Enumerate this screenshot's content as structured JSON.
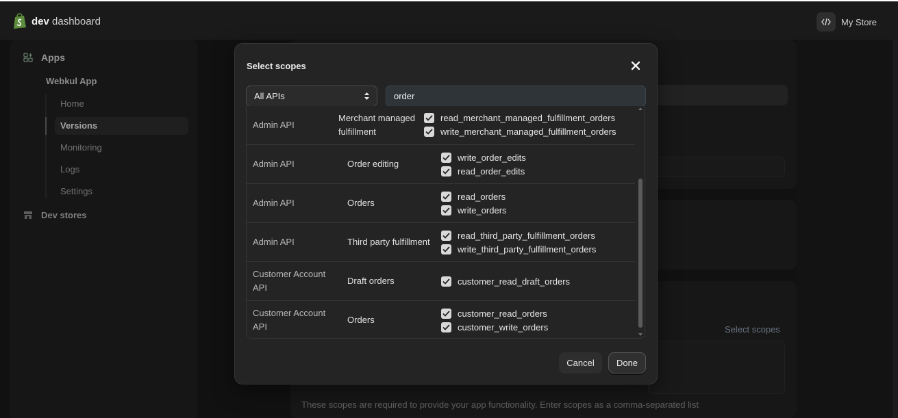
{
  "topbar": {
    "brand_bold": "dev",
    "brand_rest": " dashboard",
    "store": "My Store"
  },
  "sidebar": {
    "apps_label": "Apps",
    "app_name": "Webkul App",
    "items": [
      {
        "label": "Home"
      },
      {
        "label": "Versions",
        "active": true
      },
      {
        "label": "Monitoring"
      },
      {
        "label": "Logs"
      },
      {
        "label": "Settings"
      }
    ],
    "dev_stores": "Dev stores"
  },
  "background": {
    "select_scopes_link": "Select scopes",
    "help_text": "These scopes are required to provide your app functionality. Enter scopes as a comma-separated list"
  },
  "modal": {
    "title": "Select scopes",
    "api_filter": "All APIs",
    "search_value": "order",
    "rows": [
      {
        "api": "Admin API",
        "group": "Merchant managed fulfillment",
        "scopes": [
          "read_merchant_managed_fulfillment_orders",
          "write_merchant_managed_fulfillment_orders"
        ]
      },
      {
        "api": "Admin API",
        "group": "Order editing",
        "scopes": [
          "write_order_edits",
          "read_order_edits"
        ]
      },
      {
        "api": "Admin API",
        "group": "Orders",
        "scopes": [
          "read_orders",
          "write_orders"
        ]
      },
      {
        "api": "Admin API",
        "group": "Third party fulfillment",
        "scopes": [
          "read_third_party_fulfillment_orders",
          "write_third_party_fulfillment_orders"
        ]
      },
      {
        "api": "Customer Account API",
        "group": "Draft orders",
        "scopes": [
          "customer_read_draft_orders"
        ]
      },
      {
        "api": "Customer Account API",
        "group": "Orders",
        "scopes": [
          "customer_read_orders",
          "customer_write_orders"
        ]
      }
    ],
    "cancel_label": "Cancel",
    "done_label": "Done"
  },
  "colors": {
    "checkbox": "#d9d9d9",
    "search_bg": "#2f3439",
    "link": "#9aa9c0"
  },
  "icons": {
    "logo": "shopify-bag-icon",
    "code": "code-icon",
    "apps": "apps-grid-icon",
    "stores": "store-icon",
    "close": "close-icon",
    "select": "select-arrows-icon",
    "check": "checkmark-icon"
  }
}
